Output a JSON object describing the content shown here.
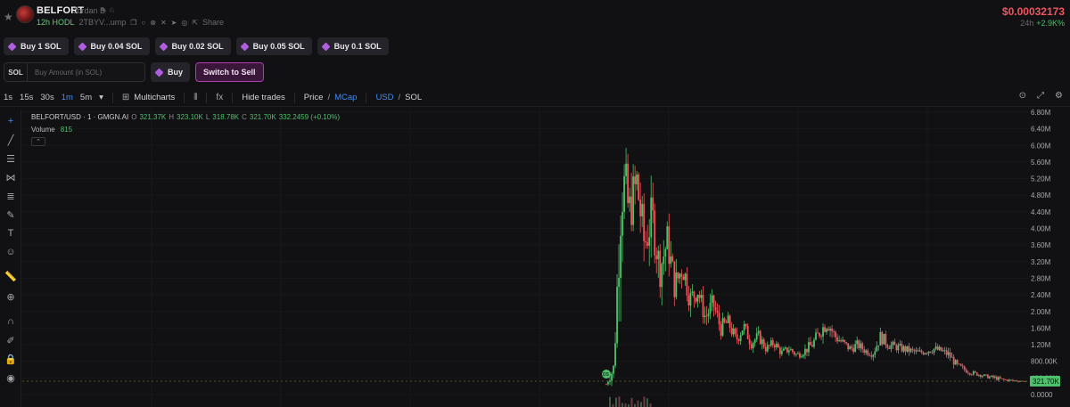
{
  "header": {
    "token_name": "BELFORT",
    "token_subtitle": "Jordan B",
    "hodl": "12h HODL",
    "address": "2TBYV...ump",
    "share_label": "Share",
    "price": "$0.00032173",
    "change_period": "24h",
    "change_value": "+2.9K%"
  },
  "buy_buttons": [
    "Buy 1 SOL",
    "Buy 0.04 SOL",
    "Buy 0.02 SOL",
    "Buy 0.05 SOL",
    "Buy 0.1 SOL"
  ],
  "trade": {
    "currency_tag": "SOL",
    "amount_placeholder": "Buy Amount (in SOL)",
    "buy_label": "Buy",
    "switch_label": "Switch to Sell"
  },
  "toolbar": {
    "timeframes": [
      "1s",
      "15s",
      "30s",
      "1m",
      "5m"
    ],
    "active_timeframe": "1m",
    "multicharts": "Multicharts",
    "fx_label": "fx",
    "hide_trades": "Hide trades",
    "price_label": "Price",
    "slash": "/",
    "mcap_label": "MCap",
    "usd_label": "USD",
    "sol_label": "SOL"
  },
  "legend": {
    "symbol": "BELFORT/USD · 1 · GMGN.AI",
    "o_key": "O",
    "o_val": "321.37K",
    "h_key": "H",
    "h_val": "323.10K",
    "l_key": "L",
    "l_val": "318.78K",
    "c_key": "C",
    "c_val": "321.70K",
    "extra": "332.2459 (+0.10%)",
    "volume_label": "Volume",
    "volume_value": "815",
    "current_label": "321.70K"
  },
  "colors": {
    "up": "#4ec06b",
    "down": "#f0555f",
    "accent": "#3f8cf6",
    "sell_border": "#b03ab0"
  },
  "chart_data": {
    "type": "candlestick",
    "title": "BELFORT/USD · 1 · GMGN.AI",
    "y_ticks": [
      "6.80M",
      "6.40M",
      "6.00M",
      "5.60M",
      "5.20M",
      "4.80M",
      "4.40M",
      "4.00M",
      "3.60M",
      "3.20M",
      "2.80M",
      "2.40M",
      "2.00M",
      "1.60M",
      "1.20M",
      "800.00K",
      "400.00K",
      "0.0000"
    ],
    "ylim": [
      0,
      6800000
    ],
    "last_price": 321700,
    "series": [
      {
        "name": "close",
        "values": [
          250000,
          650000,
          5200000,
          4400000,
          5100000,
          3600000,
          4300000,
          3000000,
          3700000,
          2600000,
          3100000,
          2300000,
          2500000,
          1850000,
          2200000,
          1600000,
          1750000,
          1300000,
          1650000,
          1250000,
          1400000,
          1100000,
          1250000,
          1000000,
          1100000,
          950000,
          1050000,
          1200000,
          1500000,
          1750000,
          1400000,
          1250000,
          1100000,
          1200000,
          1050000,
          1000000,
          1400000,
          1200000,
          1150000,
          1100000,
          1050000,
          1000000,
          1050000,
          1100000,
          1050000,
          950000,
          700000,
          600000,
          520000,
          480000,
          430000,
          400000,
          360000,
          340000,
          330000,
          322000
        ]
      },
      {
        "name": "high",
        "values": [
          300000,
          1000000,
          6150000,
          5300000,
          5800000,
          4500000,
          4900000,
          3900000,
          4100000,
          3300000,
          3400000,
          2800000,
          2700000,
          2300000,
          2400000,
          1900000,
          1900000,
          1600000,
          1800000,
          1450000,
          1550000,
          1300000,
          1350000,
          1150000,
          1200000,
          1100000,
          1200000,
          1400000,
          1700000,
          2000000,
          1650000,
          1400000,
          1300000,
          1350000,
          1200000,
          1200000,
          1550000,
          1400000,
          1300000,
          1250000,
          1200000,
          1150000,
          1200000,
          1300000,
          1200000,
          1100000,
          850000,
          700000,
          620000,
          560000,
          500000,
          520000,
          430000,
          400000,
          380000,
          325000
        ]
      },
      {
        "name": "low",
        "values": [
          200000,
          250000,
          2100000,
          3300000,
          3600000,
          2600000,
          3000000,
          2400000,
          2600000,
          2000000,
          2200000,
          1800000,
          1900000,
          1500000,
          1600000,
          1200000,
          1300000,
          1000000,
          1200000,
          950000,
          1050000,
          900000,
          950000,
          800000,
          850000,
          800000,
          850000,
          900000,
          1150000,
          1300000,
          1150000,
          1000000,
          900000,
          950000,
          880000,
          850000,
          1000000,
          1000000,
          950000,
          900000,
          880000,
          850000,
          900000,
          950000,
          880000,
          700000,
          560000,
          480000,
          430000,
          400000,
          360000,
          340000,
          320000,
          300000,
          300000,
          318000
        ]
      }
    ]
  }
}
